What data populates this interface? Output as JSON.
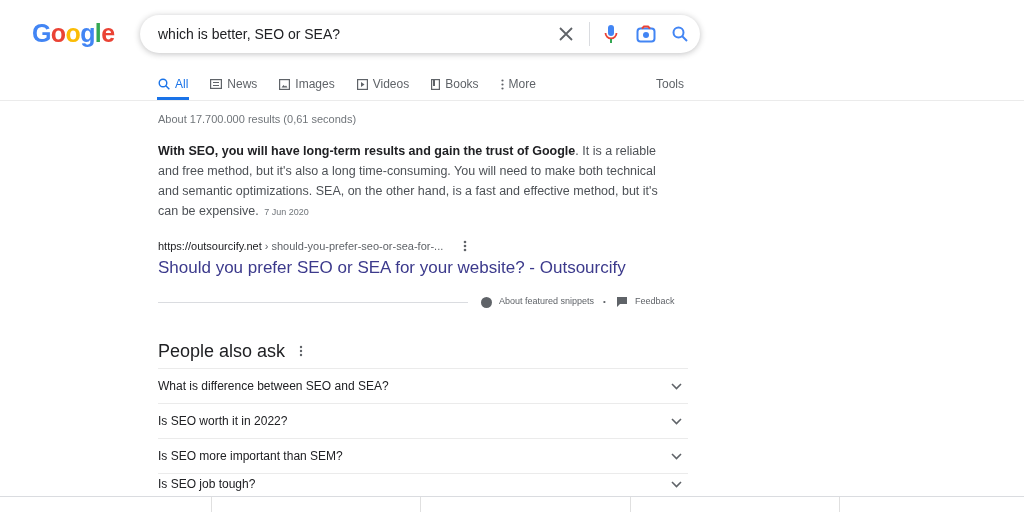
{
  "logo": {
    "text": "Google"
  },
  "search": {
    "value": "which is better, SEO or SEA?"
  },
  "tabs": [
    {
      "label": "All",
      "selected": true
    },
    {
      "label": "News",
      "selected": false
    },
    {
      "label": "Images",
      "selected": false
    },
    {
      "label": "Videos",
      "selected": false
    },
    {
      "label": "Books",
      "selected": false
    },
    {
      "label": "More",
      "selected": false
    }
  ],
  "tools": "Tools",
  "result_stats": "About 17.700.000 results (0,61 seconds)",
  "snippet": {
    "text": "**With SEO, you will have long-term results and gain the trust of Google**. It is a reliable and free method, but it's also a long time-consuming. You will need to make both technical and semantic optimizations. SEA, on the other hand, is a fast and effective method, but it's can be expensive.",
    "date": "7 Jun 2020",
    "url_site": "https://outsourcify.net",
    "url_path": "› should-you-prefer-seo-or-sea-for-...",
    "title": "Should you prefer SEO or SEA for your website? - Outsourcify",
    "about": "About featured snippets",
    "separator": "•",
    "feedback": "Feedback"
  },
  "people_also_ask": {
    "title": "People also ask",
    "questions": [
      {
        "text": "What is difference between SEO and SEA?",
        "expanded": false
      },
      {
        "text": "Is SEO worth it in 2022?",
        "expanded": false
      },
      {
        "text": "Is SEO more important than SEM?",
        "expanded": false
      },
      {
        "text": "Is SEO job tough?",
        "expanded": false
      }
    ]
  }
}
